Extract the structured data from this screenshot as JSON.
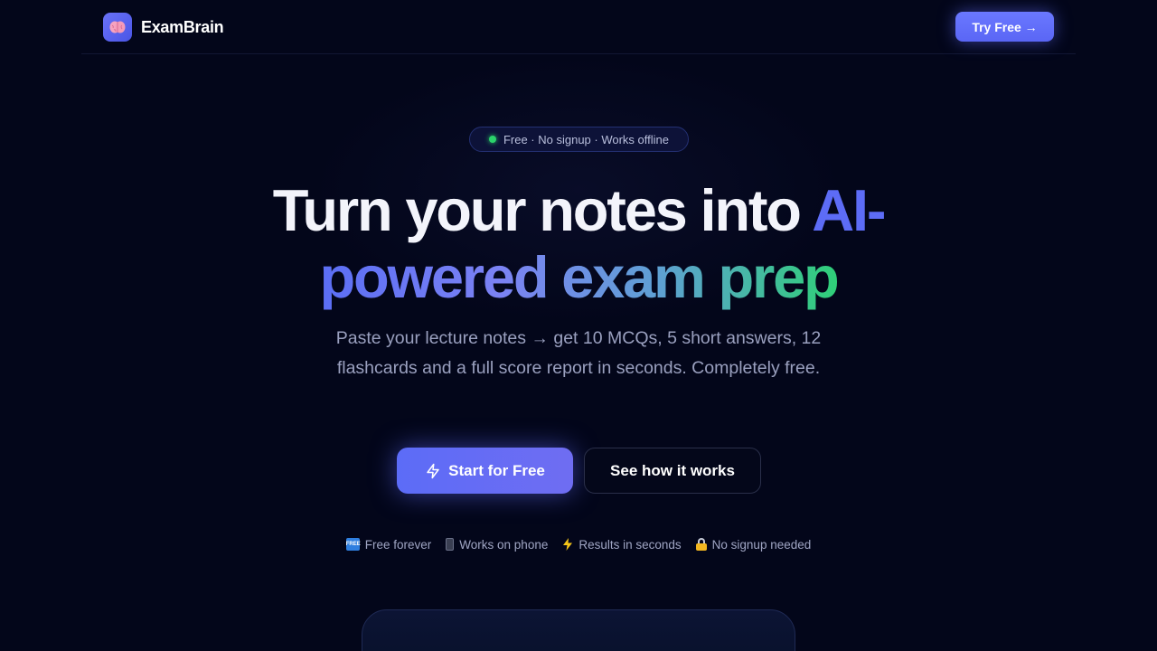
{
  "nav": {
    "brand_name": "ExamBrain",
    "brand_icon": "brain-icon",
    "try_label": "Try Free →"
  },
  "hero": {
    "badge": "Free · No signup · Works offline",
    "headline_plain": "Turn your notes into ",
    "headline_ai": "AI-",
    "headline_gradient": "powered exam prep",
    "subtitle": "Paste your lecture notes → get 10 MCQs, 5 short answers, 12 flashcards and a full score report in seconds. Completely free.",
    "cta_primary": "Start for Free",
    "cta_secondary": "See how it works"
  },
  "features": [
    {
      "icon": "free-badge-icon",
      "label": "Free forever"
    },
    {
      "icon": "phone-icon",
      "label": "Works on phone"
    },
    {
      "icon": "lightning-icon",
      "label": "Results in seconds"
    },
    {
      "icon": "lock-icon",
      "label": "No signup needed"
    }
  ],
  "colors": {
    "background": "#03061a",
    "accent": "#5c6cf7",
    "gradient_end": "#2fcf78",
    "status_dot": "#2bd36b"
  }
}
